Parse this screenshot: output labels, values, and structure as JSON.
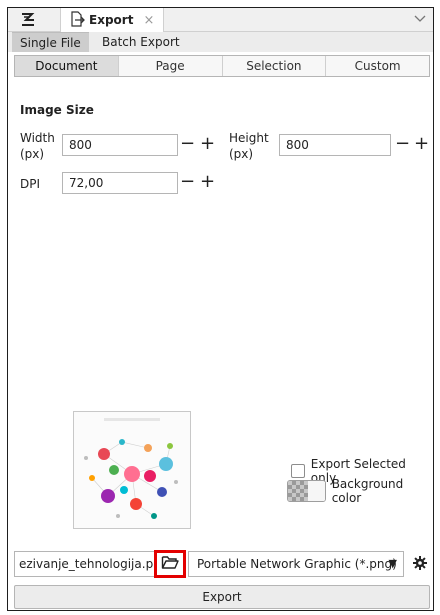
{
  "dock": {
    "tab_title": "Export",
    "close_glyph": "×"
  },
  "mode_tabs": [
    "Single File",
    "Batch Export"
  ],
  "area_tabs": [
    "Document",
    "Page",
    "Selection",
    "Custom"
  ],
  "image_size": {
    "title": "Image Size",
    "width_label": "Width",
    "width_unit": "(px)",
    "width_value": "800",
    "height_label": "Height",
    "height_unit": "(px)",
    "height_value": "800",
    "dpi_label": "DPI",
    "dpi_value": "72,00",
    "minus": "−",
    "plus": "+"
  },
  "options": {
    "export_selected_only": "Export Selected only",
    "background_color": "Background color"
  },
  "file": {
    "filename": "ezivanje_tehnologija.png",
    "format": "Portable Network Graphic (*.png)"
  },
  "export_button": "Export",
  "icons": {
    "dock_menu": "dock-menu-icon",
    "export_tab": "export-doc-icon",
    "folder": "folder-open-icon",
    "gear": "gear-icon",
    "chevron": "chevron-down-icon"
  },
  "colors": {
    "highlight": "#e30000"
  }
}
